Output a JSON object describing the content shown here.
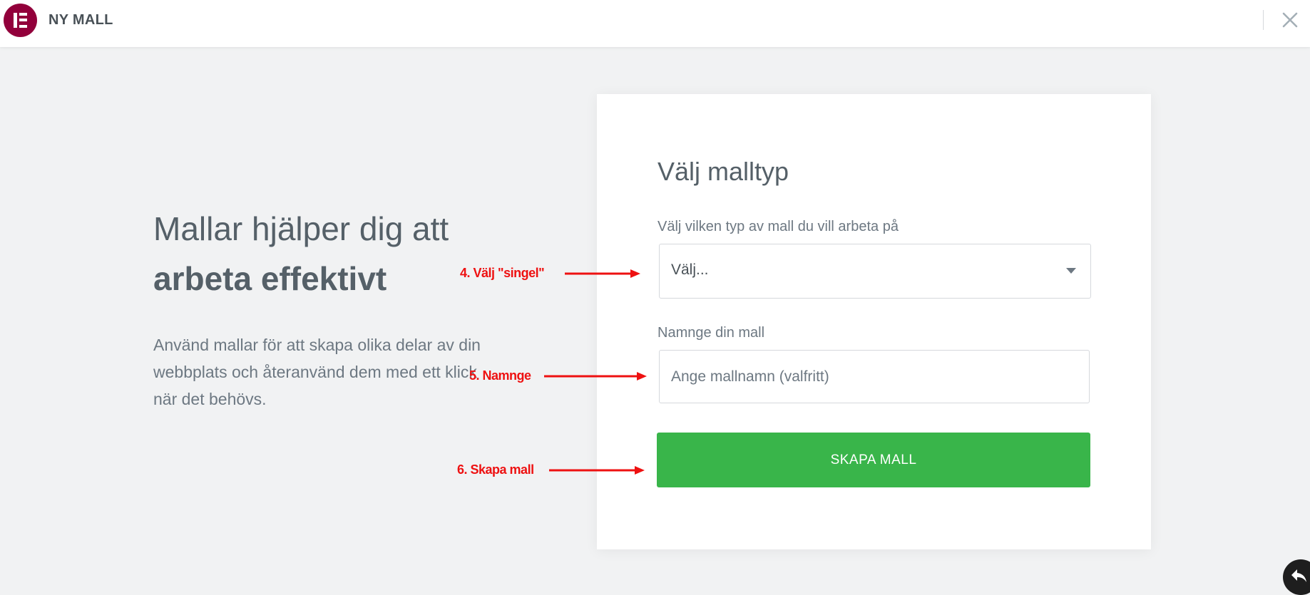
{
  "header": {
    "logo_icon": "elementor-logo-icon",
    "title": "NY MALL",
    "close_icon": "close-icon"
  },
  "intro": {
    "headline_line1": "Mallar hjälper dig att",
    "headline_line2": "arbeta effektivt",
    "description": "Använd mallar för att skapa olika delar av din webbplats och återanvänd dem med ett klick när det behövs."
  },
  "form": {
    "title": "Välj malltyp",
    "type_label": "Välj vilken typ av mall du vill arbeta på",
    "type_select_value": "Välj...",
    "name_label": "Namnge din mall",
    "name_input_value": "",
    "name_input_placeholder": "Ange mallnamn (valfritt)",
    "submit_label": "SKAPA MALL"
  },
  "annotations": [
    {
      "text": "4. Välj \"singel\""
    },
    {
      "text": "5. Namnge"
    },
    {
      "text": "6. Skapa mall"
    }
  ],
  "floating": {
    "back_icon": "reply-arrow-icon"
  },
  "colors": {
    "brand": "#92003b",
    "accent_button": "#39b54a",
    "annotation": "#ee1111",
    "page_background": "#f1f2f3"
  }
}
